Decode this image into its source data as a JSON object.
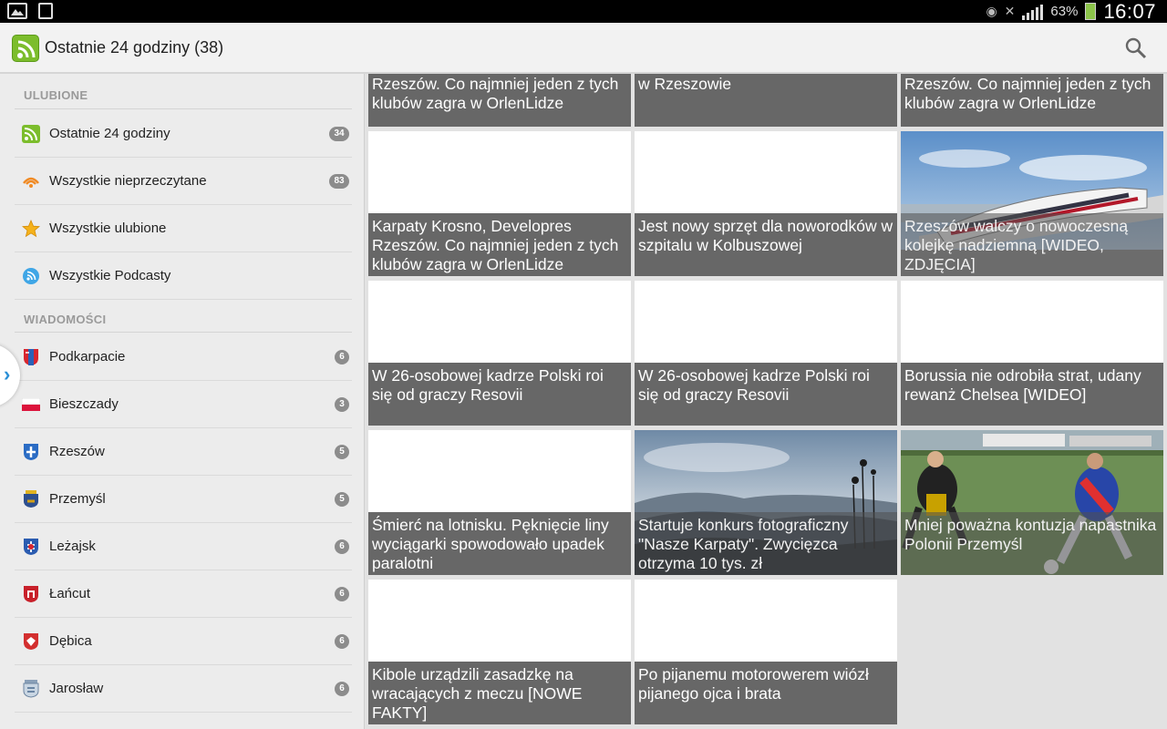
{
  "statusbar": {
    "battery": "63%",
    "time": "16:07"
  },
  "header": {
    "title": "Ostatnie 24 godziny (38)"
  },
  "sidebar": {
    "favorites_heading": "ULUBIONE",
    "news_heading": "WIADOMOŚCI",
    "favorites": [
      {
        "label": "Ostatnie 24 godziny",
        "count": "34",
        "icon": "rss-icon"
      },
      {
        "label": "Wszystkie nieprzeczytane",
        "count": "83",
        "icon": "unread-icon"
      },
      {
        "label": "Wszystkie ulubione",
        "count": "",
        "icon": "star-icon"
      },
      {
        "label": "Wszystkie Podcasty",
        "count": "",
        "icon": "podcast-icon"
      }
    ],
    "news": [
      {
        "label": "Podkarpacie",
        "count": "6",
        "icon": "podkarpacie-crest-icon"
      },
      {
        "label": "Bieszczady",
        "count": "3",
        "icon": "flag-icon"
      },
      {
        "label": "Rzeszów",
        "count": "5",
        "icon": "rzeszow-crest-icon"
      },
      {
        "label": "Przemyśl",
        "count": "5",
        "icon": "przemysl-crest-icon"
      },
      {
        "label": "Leżajsk",
        "count": "6",
        "icon": "lezajsk-crest-icon"
      },
      {
        "label": "Łańcut",
        "count": "6",
        "icon": "lancut-crest-icon"
      },
      {
        "label": "Dębica",
        "count": "6",
        "icon": "debica-crest-icon"
      },
      {
        "label": "Jarosław",
        "count": "6",
        "icon": "jaroslaw-crest-icon"
      }
    ]
  },
  "articles": [
    {
      "title": "Karpaty Krosno, Developres Rzeszów. Co najmniej jeden z tych klubów zagra w OrlenLidze"
    },
    {
      "title": "Dziki tor rowerowy na Lisiej Górze w Rzeszowie"
    },
    {
      "title": "Karpaty Krosno, Developres Rzeszów. Co najmniej jeden z tych klubów zagra w OrlenLidze"
    },
    {
      "title": "Karpaty Krosno, Developres Rzeszów. Co najmniej jeden z tych klubów zagra w OrlenLidze"
    },
    {
      "title": "Jest nowy sprzęt dla noworodków w szpitalu w Kolbuszowej"
    },
    {
      "title": "Rzeszów walczy o nowoczesną kolejkę nadziemną [WIDEO, ZDJĘCIA]"
    },
    {
      "title": "W 26-osobowej kadrze Polski roi się od graczy Resovii"
    },
    {
      "title": "W 26-osobowej kadrze Polski roi się od graczy Resovii"
    },
    {
      "title": "Borussia nie odrobiła strat, udany rewanż Chelsea [WIDEO]"
    },
    {
      "title": "Śmierć na lotnisku. Pęknięcie liny wyciągarki spowodowało upadek paralotni"
    },
    {
      "title": "Startuje konkurs fotograficzny \"Nasze Karpaty\". Zwycięzca otrzyma 10 tys. zł"
    },
    {
      "title": "Mniej poważna kontuzja napastnika Polonii Przemyśl"
    },
    {
      "title": "Kibole urządzili zasadzkę na wracających z meczu [NOWE FAKTY]"
    },
    {
      "title": "Po pijanemu motorowerem wiózł pijanego ojca i brata"
    }
  ]
}
